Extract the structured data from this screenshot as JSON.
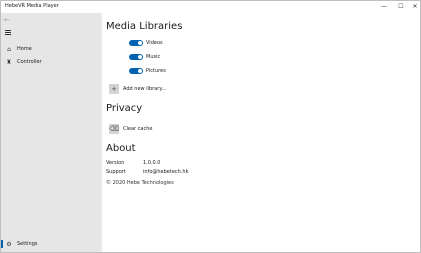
{
  "window": {
    "title": "HebeVR Media Player",
    "minimize_glyph": "—",
    "maximize_glyph": "☐",
    "close_glyph": "✕"
  },
  "sidebar": {
    "back_glyph": "←",
    "items": [
      {
        "label": "Home",
        "icon": "home-icon",
        "glyph": "⌂"
      },
      {
        "label": "Controller",
        "icon": "controller-icon",
        "glyph": "♜"
      }
    ],
    "footer": {
      "label": "Settings",
      "icon": "gear-icon",
      "glyph": "⚙"
    }
  },
  "main": {
    "media_libraries": {
      "heading": "Media Libraries",
      "toggles": [
        {
          "label": "Videos",
          "on": true
        },
        {
          "label": "Music",
          "on": true
        },
        {
          "label": "Pictures",
          "on": true
        }
      ],
      "add_library_label": "Add new library...",
      "add_glyph": "+"
    },
    "privacy": {
      "heading": "Privacy",
      "clear_cache_label": "Clear cache",
      "clear_glyph": "⌫"
    },
    "about": {
      "heading": "About",
      "version_key": "Version",
      "version_value": "1.0.0.0",
      "support_key": "Support",
      "support_value": "info@hebetech.hk",
      "copyright": "© 2020 Hebe Technologies"
    }
  },
  "colors": {
    "accent": "#0063b1",
    "sidebar_bg": "#e6e6e6"
  }
}
